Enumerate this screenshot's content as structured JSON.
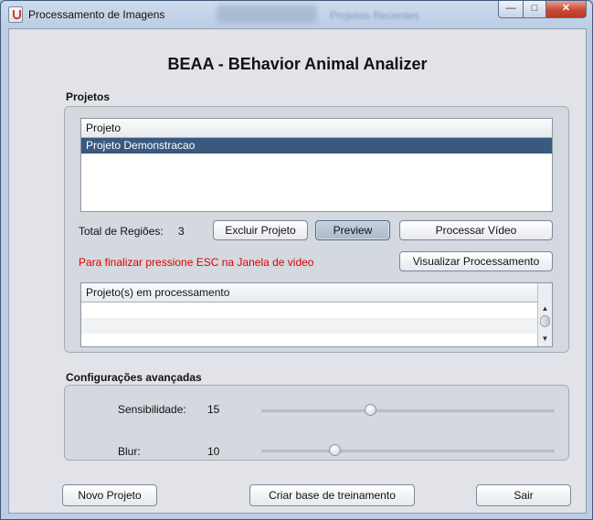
{
  "window": {
    "title": "Processamento de Imagens",
    "background_title": "Projetos Recentes",
    "controls": {
      "minimize": "—",
      "maximize": "□",
      "close": "✕"
    }
  },
  "heading": "BEAA - BEhavior Animal Analizer",
  "projects_section": {
    "label": "Projetos",
    "table": {
      "header": "Projeto",
      "rows": [
        "Projeto Demonstracao"
      ],
      "selected": "Projeto Demonstracao"
    },
    "total_label": "Total de Regiões:",
    "total_value": "3",
    "buttons": {
      "delete": "Excluir Projeto",
      "preview": "Preview",
      "process": "Processar Vídeo",
      "view_processing": "Visualizar Processamento"
    },
    "esc_hint": "Para finalizar pressione ESC na Janela de video",
    "processing_table": {
      "header": "Projeto(s) em processamento",
      "rows": []
    }
  },
  "advanced_section": {
    "label": "Configurações avançadas",
    "sensitivity": {
      "label": "Sensibilidade:",
      "value": "15",
      "level": 0.37
    },
    "blur": {
      "label": "Blur:",
      "value": "10",
      "level": 0.25
    }
  },
  "footer_buttons": {
    "new_project": "Novo Projeto",
    "create_training_base": "Criar base de treinamento",
    "exit": "Sair"
  },
  "colors": {
    "selection": "#395a7e",
    "hint": "#e00000",
    "close_button": "#c74a35"
  }
}
